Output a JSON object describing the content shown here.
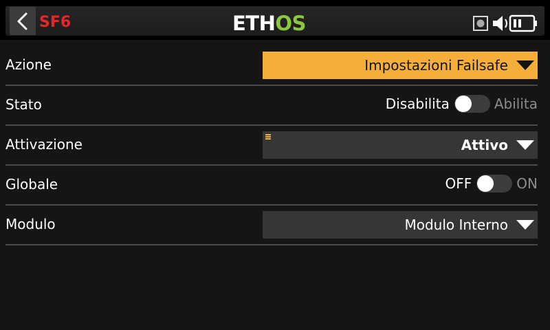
{
  "header": {
    "page_label": "SF6",
    "logo_text_left": "ETH",
    "logo_text_right": "OS",
    "logo_colors": {
      "left": "#ffffff",
      "right": "#8dc63f"
    },
    "icons": [
      "back-arrow-icon",
      "record-icon",
      "speaker-icon",
      "battery-icon"
    ]
  },
  "rows": {
    "azione": {
      "label": "Azione",
      "value": "Impostazioni Failsafe"
    },
    "stato": {
      "label": "Stato",
      "off_label": "Disabilita",
      "on_label": "Abilita",
      "state": "off"
    },
    "attivazione": {
      "label": "Attivazione",
      "value": "Attivo"
    },
    "globale": {
      "label": "Globale",
      "off_label": "OFF",
      "on_label": "ON",
      "state": "off"
    },
    "modulo": {
      "label": "Modulo",
      "value": "Modulo Interno"
    }
  },
  "colors": {
    "accent": "#f6ae3a",
    "page_label": "#e8262a",
    "background": "#151515"
  }
}
